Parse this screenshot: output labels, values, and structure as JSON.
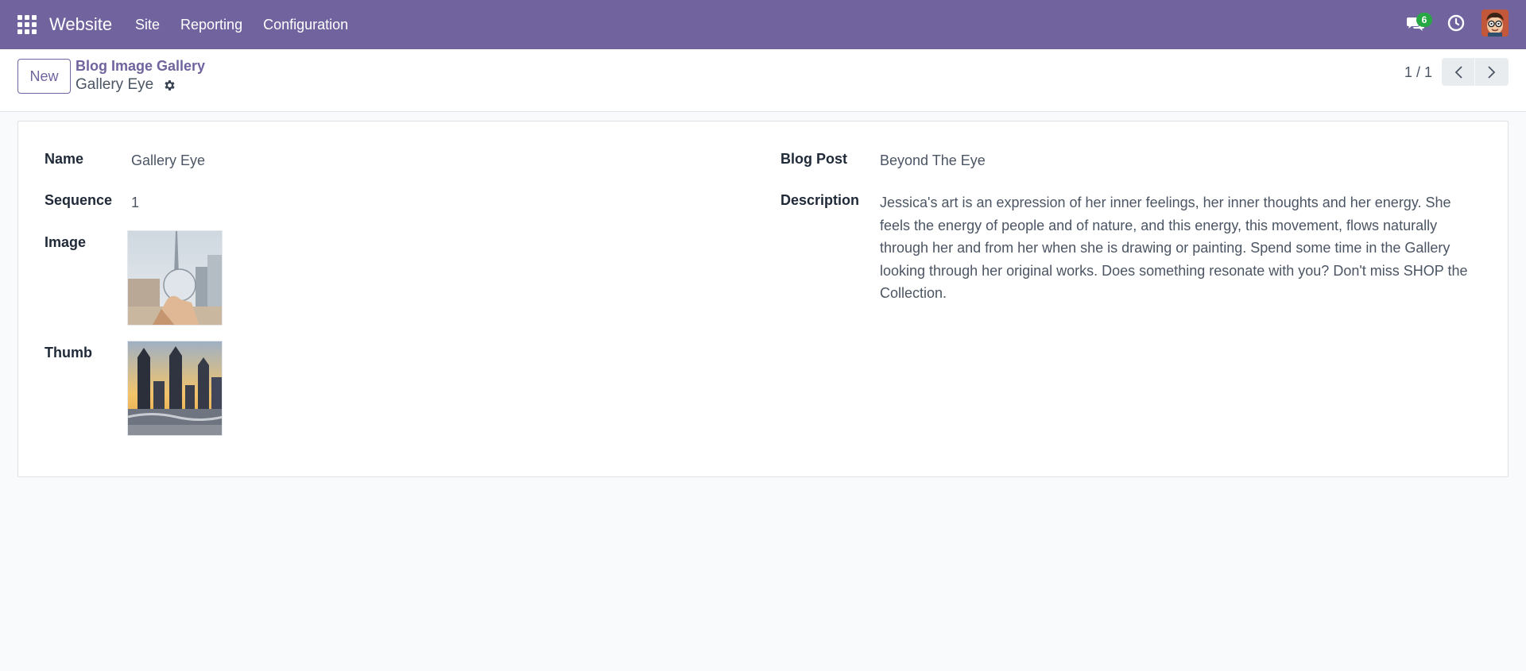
{
  "navbar": {
    "brand": "Website",
    "menu": [
      "Site",
      "Reporting",
      "Configuration"
    ],
    "chat_count": "6"
  },
  "control_panel": {
    "new_label": "New",
    "breadcrumb": "Blog Image Gallery",
    "record_title": "Gallery Eye",
    "pager": "1 / 1"
  },
  "form": {
    "name_label": "Name",
    "name_value": "Gallery Eye",
    "sequence_label": "Sequence",
    "sequence_value": "1",
    "image_label": "Image",
    "thumb_label": "Thumb",
    "blog_post_label": "Blog Post",
    "blog_post_value": "Beyond The Eye",
    "description_label": "Description",
    "description_value": "Jessica's art is an expression of her inner feelings, her inner thoughts and her energy. She feels the energy of people and of nature, and this energy, this movement, flows naturally through her and from her when she is drawing or painting. Spend some time in the Gallery looking through her original works. Does something resonate with you? Don't miss SHOP the Collection."
  },
  "colors": {
    "brand": "#71639e",
    "badge": "#28a745"
  },
  "icons": [
    "apps-grid-icon",
    "chat-icon",
    "clock-icon",
    "gear-icon",
    "chevron-left-icon",
    "chevron-right-icon"
  ]
}
